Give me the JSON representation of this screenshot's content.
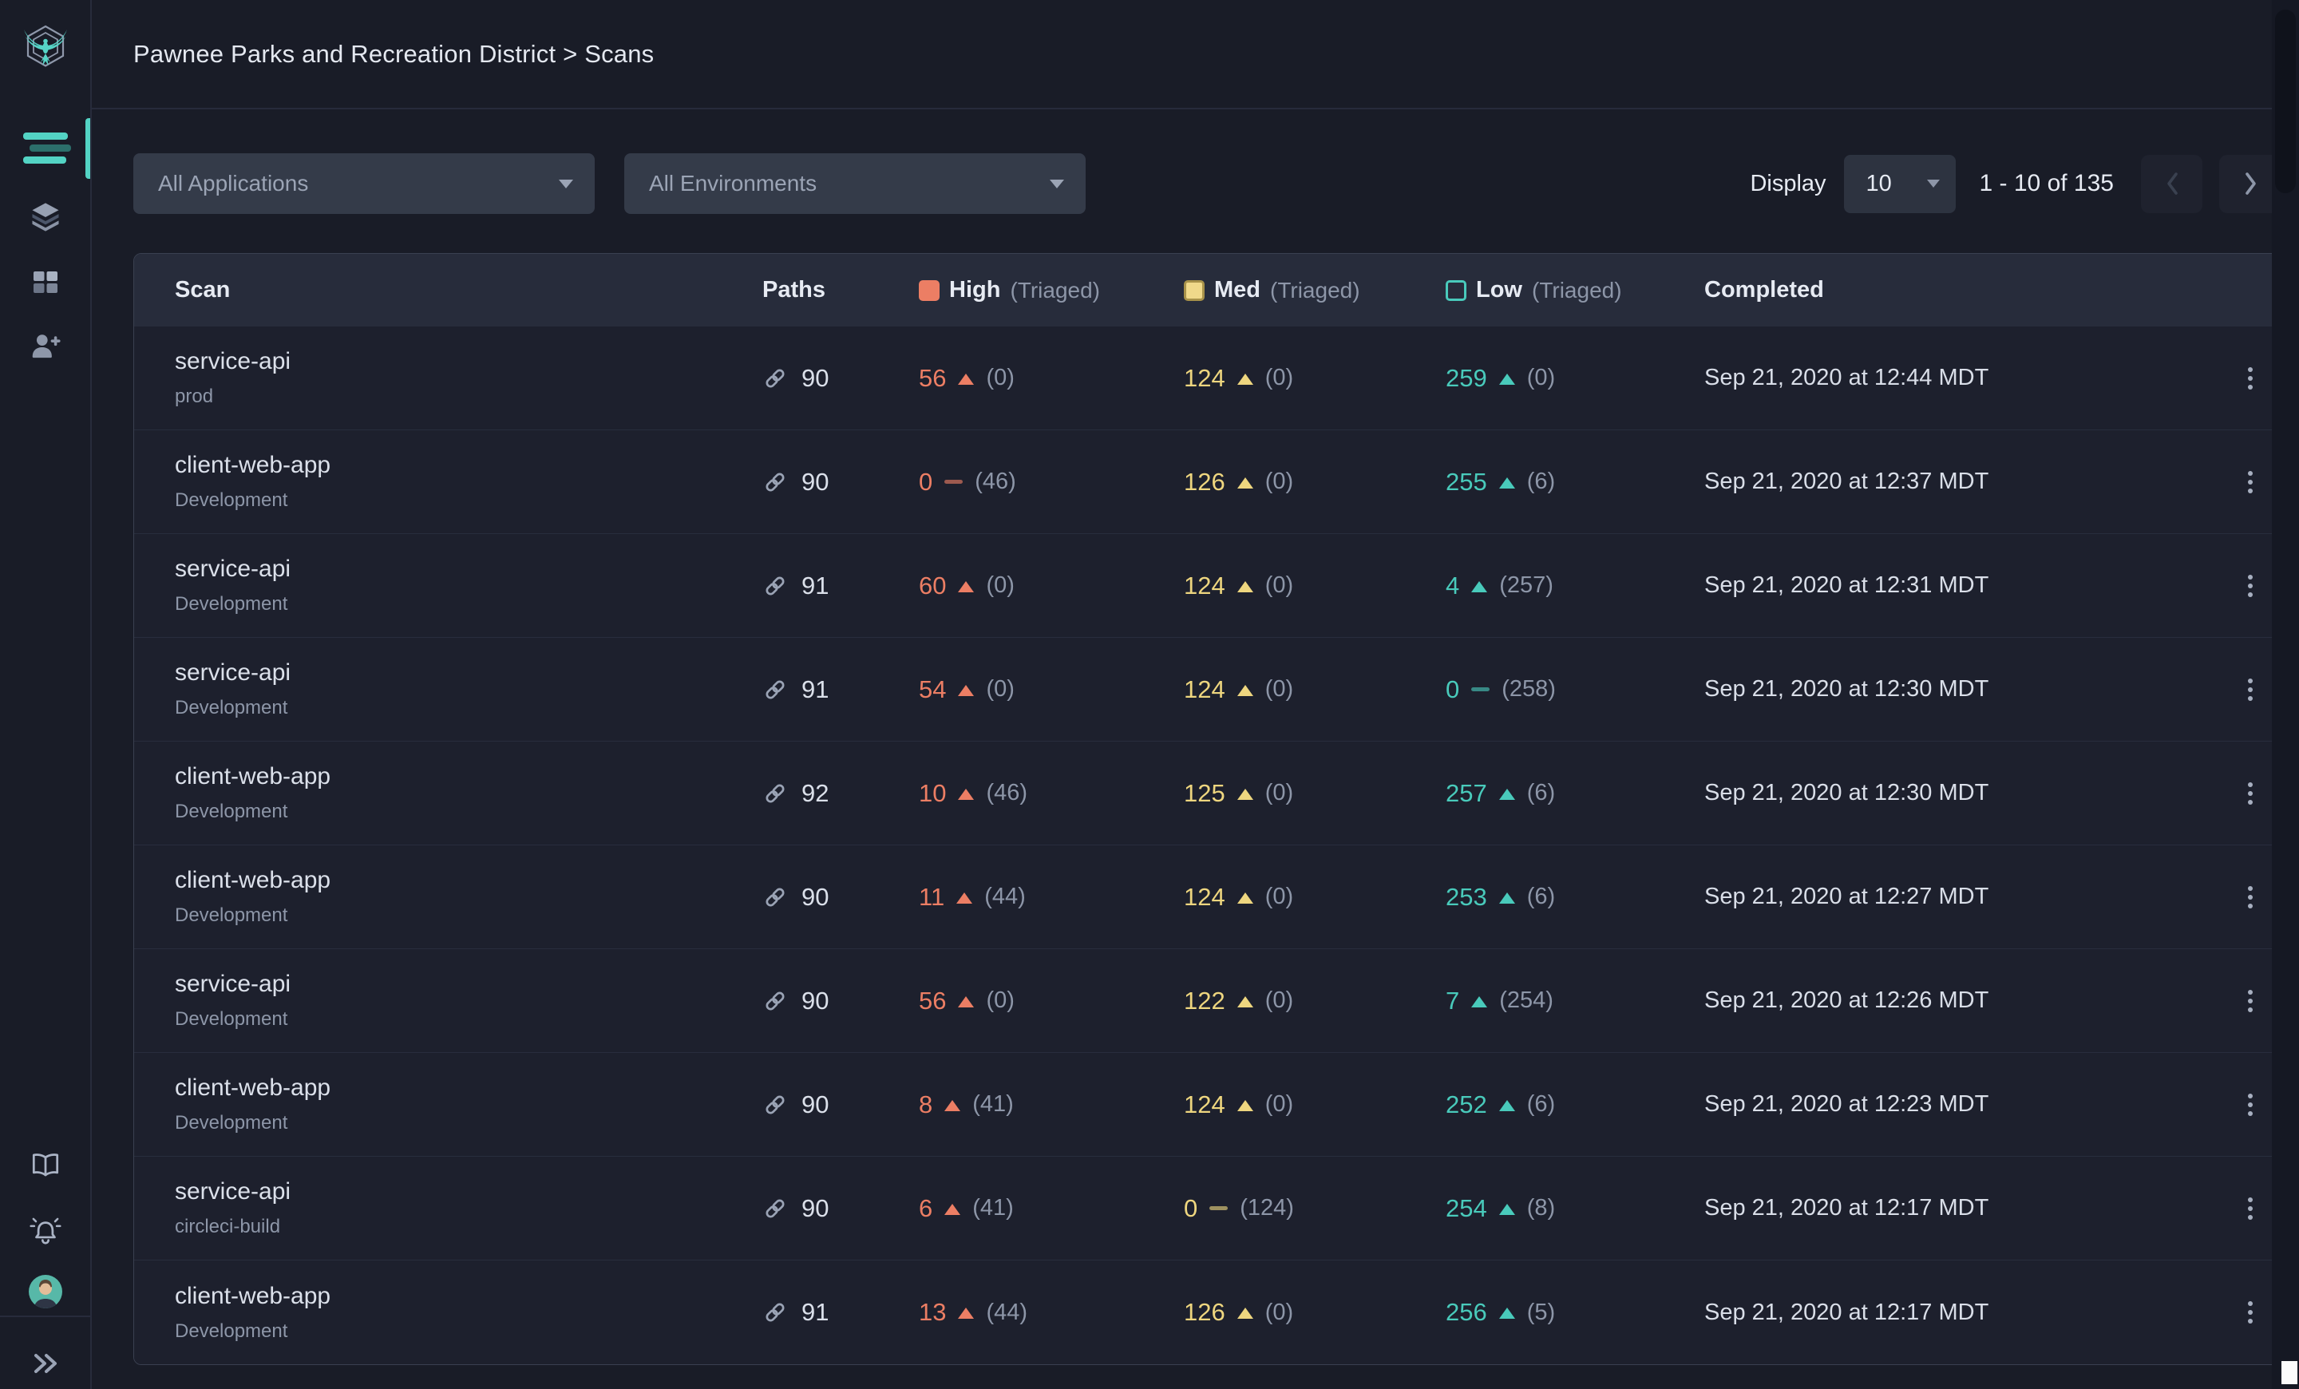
{
  "topbar": {
    "breadcrumb": "Pawnee Parks and Recreation District > Scans"
  },
  "sidebar": {
    "logo": "stackhawk-hawk-logo",
    "items": [
      {
        "id": "scans",
        "icon": "scan-list-icon",
        "active": true
      },
      {
        "id": "layers",
        "icon": "layers-icon",
        "active": false
      },
      {
        "id": "applications",
        "icon": "grid-icon",
        "active": false
      },
      {
        "id": "invite-user",
        "icon": "user-add-icon",
        "active": false
      }
    ],
    "bottom_items": [
      {
        "id": "docs",
        "icon": "book-icon"
      },
      {
        "id": "notifications",
        "icon": "bell-icon"
      },
      {
        "id": "profile",
        "icon": "user-avatar"
      },
      {
        "id": "expand",
        "icon": "double-chevron-right-icon"
      }
    ]
  },
  "filters": {
    "applications": {
      "value": "All Applications"
    },
    "environments": {
      "value": "All Environments"
    }
  },
  "pagination": {
    "display_label": "Display",
    "page_size": "10",
    "range_text": "1 - 10 of 135"
  },
  "table": {
    "columns": {
      "scan": "Scan",
      "paths": "Paths",
      "high": {
        "label": "High",
        "triaged": "(Triaged)"
      },
      "med": {
        "label": "Med",
        "triaged": "(Triaged)"
      },
      "low": {
        "label": "Low",
        "triaged": "(Triaged)"
      },
      "completed": "Completed"
    },
    "rows": [
      {
        "name": "service-api",
        "environment": "prod",
        "paths": "90",
        "high": {
          "count": "56",
          "trend": "up",
          "triaged": "(0)"
        },
        "med": {
          "count": "124",
          "trend": "up",
          "triaged": "(0)"
        },
        "low": {
          "count": "259",
          "trend": "up",
          "triaged": "(0)"
        },
        "completed": "Sep 21, 2020 at 12:44 MDT"
      },
      {
        "name": "client-web-app",
        "environment": "Development",
        "paths": "90",
        "high": {
          "count": "0",
          "trend": "flat",
          "triaged": "(46)"
        },
        "med": {
          "count": "126",
          "trend": "up",
          "triaged": "(0)"
        },
        "low": {
          "count": "255",
          "trend": "up",
          "triaged": "(6)"
        },
        "completed": "Sep 21, 2020 at 12:37 MDT"
      },
      {
        "name": "service-api",
        "environment": "Development",
        "paths": "91",
        "high": {
          "count": "60",
          "trend": "up",
          "triaged": "(0)"
        },
        "med": {
          "count": "124",
          "trend": "up",
          "triaged": "(0)"
        },
        "low": {
          "count": "4",
          "trend": "up",
          "triaged": "(257)"
        },
        "completed": "Sep 21, 2020 at 12:31 MDT"
      },
      {
        "name": "service-api",
        "environment": "Development",
        "paths": "91",
        "high": {
          "count": "54",
          "trend": "up",
          "triaged": "(0)"
        },
        "med": {
          "count": "124",
          "trend": "up",
          "triaged": "(0)"
        },
        "low": {
          "count": "0",
          "trend": "flat",
          "triaged": "(258)"
        },
        "completed": "Sep 21, 2020 at 12:30 MDT"
      },
      {
        "name": "client-web-app",
        "environment": "Development",
        "paths": "92",
        "high": {
          "count": "10",
          "trend": "up",
          "triaged": "(46)"
        },
        "med": {
          "count": "125",
          "trend": "up",
          "triaged": "(0)"
        },
        "low": {
          "count": "257",
          "trend": "up",
          "triaged": "(6)"
        },
        "completed": "Sep 21, 2020 at 12:30 MDT"
      },
      {
        "name": "client-web-app",
        "environment": "Development",
        "paths": "90",
        "high": {
          "count": "11",
          "trend": "up",
          "triaged": "(44)"
        },
        "med": {
          "count": "124",
          "trend": "up",
          "triaged": "(0)"
        },
        "low": {
          "count": "253",
          "trend": "up",
          "triaged": "(6)"
        },
        "completed": "Sep 21, 2020 at 12:27 MDT"
      },
      {
        "name": "service-api",
        "environment": "Development",
        "paths": "90",
        "high": {
          "count": "56",
          "trend": "up",
          "triaged": "(0)"
        },
        "med": {
          "count": "122",
          "trend": "up",
          "triaged": "(0)"
        },
        "low": {
          "count": "7",
          "trend": "up",
          "triaged": "(254)"
        },
        "completed": "Sep 21, 2020 at 12:26 MDT"
      },
      {
        "name": "client-web-app",
        "environment": "Development",
        "paths": "90",
        "high": {
          "count": "8",
          "trend": "up",
          "triaged": "(41)"
        },
        "med": {
          "count": "124",
          "trend": "up",
          "triaged": "(0)"
        },
        "low": {
          "count": "252",
          "trend": "up",
          "triaged": "(6)"
        },
        "completed": "Sep 21, 2020 at 12:23 MDT"
      },
      {
        "name": "service-api",
        "environment": "circleci-build",
        "paths": "90",
        "high": {
          "count": "6",
          "trend": "up",
          "triaged": "(41)"
        },
        "med": {
          "count": "0",
          "trend": "flat",
          "triaged": "(124)"
        },
        "low": {
          "count": "254",
          "trend": "up",
          "triaged": "(8)"
        },
        "completed": "Sep 21, 2020 at 12:17 MDT"
      },
      {
        "name": "client-web-app",
        "environment": "Development",
        "paths": "91",
        "high": {
          "count": "13",
          "trend": "up",
          "triaged": "(44)"
        },
        "med": {
          "count": "126",
          "trend": "up",
          "triaged": "(0)"
        },
        "low": {
          "count": "256",
          "trend": "up",
          "triaged": "(5)"
        },
        "completed": "Sep 21, 2020 at 12:17 MDT"
      }
    ]
  },
  "colors": {
    "accent_teal": "#53d3c4",
    "high": "#ec7e64",
    "med": "#eed67f",
    "low": "#49cabb",
    "background": "#191c27"
  }
}
